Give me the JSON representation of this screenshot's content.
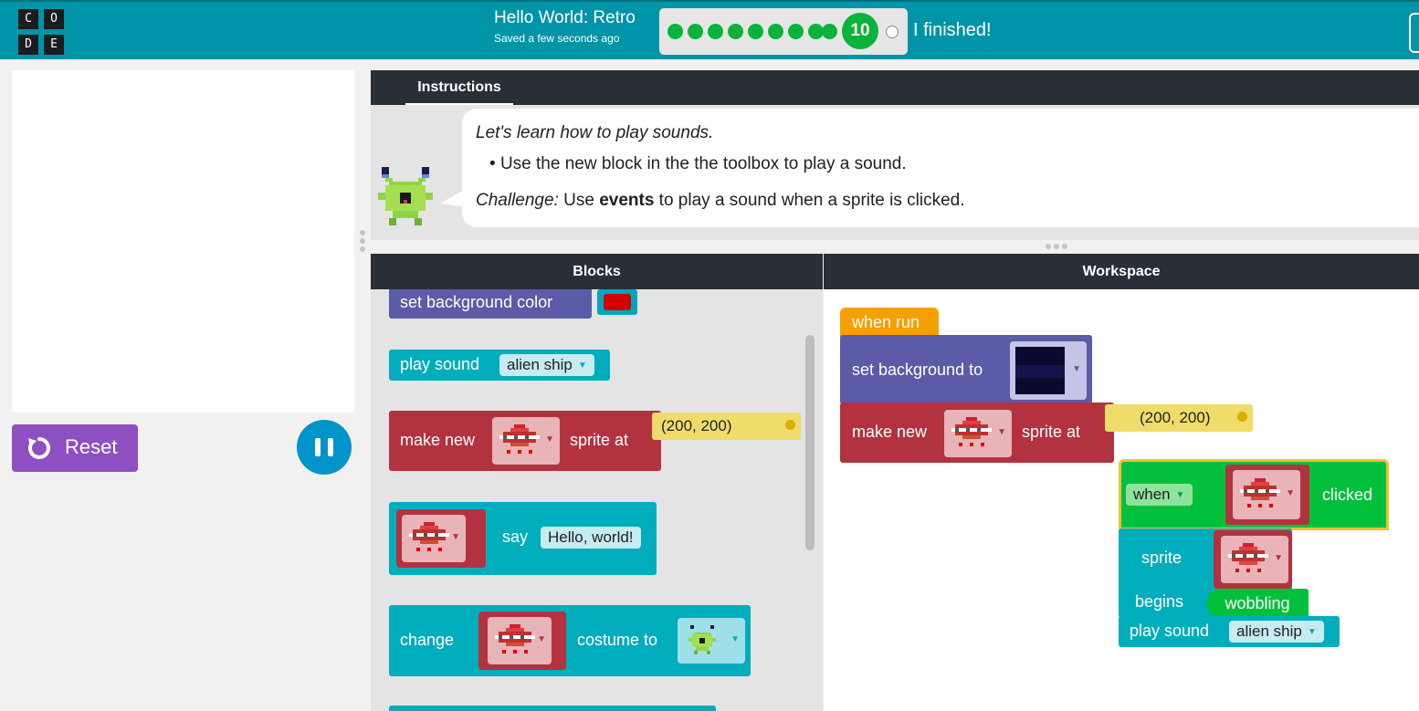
{
  "header": {
    "logo_letters": [
      "C",
      "O",
      "D",
      "E"
    ],
    "project_title": "Hello World: Retro",
    "saved_status": "Saved a few seconds ago",
    "progress_level": "10",
    "completed_levels": 9,
    "finished_label": "I finished!"
  },
  "left_panel": {
    "reset_label": "Reset",
    "pause_icon": "pause-icon"
  },
  "instructions": {
    "tab_label": "Instructions",
    "intro": "Let's learn how to play sounds.",
    "bullet": "Use the new block in the the toolbox to play a sound.",
    "challenge_label": "Challenge:",
    "challenge_pre": " Use ",
    "challenge_bold": "events",
    "challenge_post": " to play a sound when a sprite is clicked."
  },
  "blocks_panel": {
    "header": "Blocks",
    "items": {
      "set_bg_color": "set background color",
      "play_sound": "play sound",
      "play_sound_value": "alien ship",
      "make_new": "make new",
      "sprite_at": "sprite at",
      "coords": "(200, 200)",
      "say": "say",
      "say_value": "Hello, world!",
      "change": "change",
      "costume_to": "costume to"
    }
  },
  "workspace_panel": {
    "header": "Workspace",
    "when_run": "when run",
    "set_background_to": "set background to",
    "make_new": "make new",
    "sprite_at": "sprite at",
    "coords": "(200, 200)",
    "when": "when",
    "clicked": "clicked",
    "sprite": "sprite",
    "begins": "begins",
    "wobbling": "wobbling",
    "play_sound": "play sound",
    "play_sound_value": "alien ship"
  },
  "colors": {
    "header_bg": "#0094a8",
    "reset_purple": "#8e4fc3",
    "pause_blue": "#0094ca",
    "progress_green": "#0bb33a",
    "block_purple": "#5b5ba8",
    "block_teal": "#00adbd",
    "block_red": "#b3323f",
    "block_orange": "#f6a000",
    "block_green": "#03c03c"
  }
}
